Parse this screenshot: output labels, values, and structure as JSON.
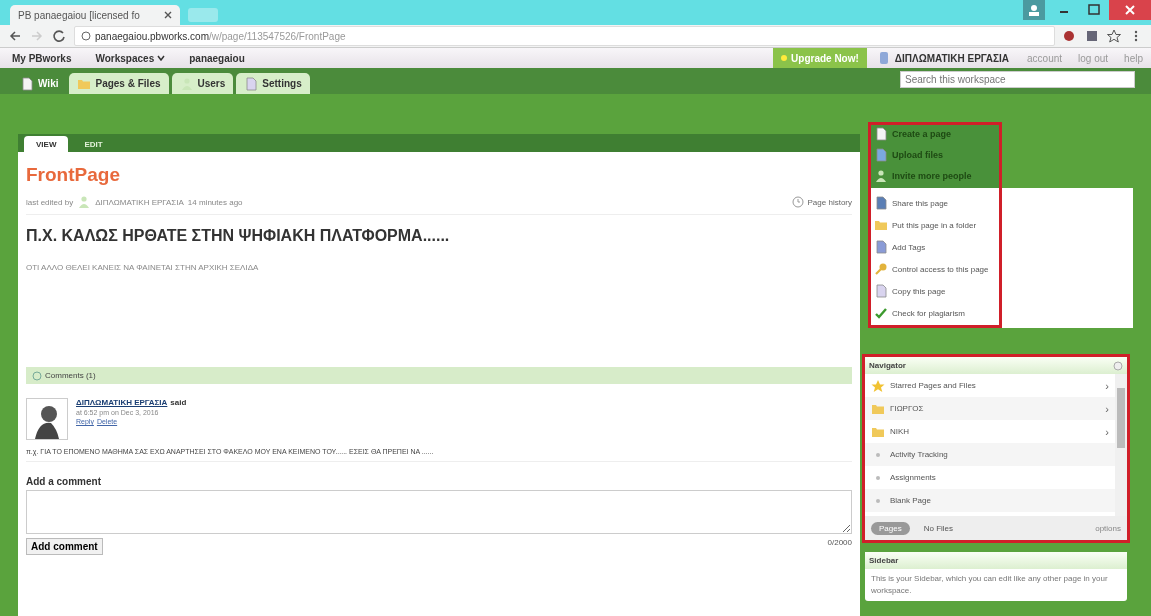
{
  "browser": {
    "tab_title": "PB panaegaiou [licensed fo",
    "url_host": "panaegaiou.pbworks.com",
    "url_path": "/w/page/113547526/FrontPage"
  },
  "topbar": {
    "links": [
      {
        "label": "My PBworks",
        "kind": "plain"
      },
      {
        "label": "Workspaces",
        "kind": "menu"
      },
      {
        "label": "panaegaiou",
        "kind": "plain"
      }
    ],
    "upgrade": "Upgrade Now!",
    "user": "ΔΙΠΛΩΜΑΤΙΚΗ ΕΡΓΑΣΙΑ",
    "right_links": [
      "account",
      "log out",
      "help"
    ]
  },
  "nav": {
    "tabs": [
      {
        "label": "Wiki",
        "selected": true
      },
      {
        "label": "Pages & Files",
        "selected": false
      },
      {
        "label": "Users",
        "selected": false
      },
      {
        "label": "Settings",
        "selected": false
      }
    ],
    "search": {
      "placeholder": "Search this workspace"
    }
  },
  "page": {
    "mode_tabs": [
      {
        "label": "VIEW",
        "selected": true
      },
      {
        "label": "EDIT",
        "selected": false
      }
    ],
    "title": "FrontPage",
    "meta_prefix": "last edited by",
    "meta_user": "ΔΙΠΛΩΜΑΤΙΚΗ ΕΡΓΑΣΙΑ",
    "meta_time": "14 minutes ago",
    "history": "Page history",
    "heading": "Π.Χ. ΚΑΛΩΣ ΗΡΘΑΤΕ ΣΤΗΝ ΨΗΦΙΑΚΗ ΠΛΑΤΦΟΡΜΑ......",
    "body": "ΟΤΙ ΑΛΛΟ ΘΕΛΕΙ ΚΑΝΕΙΣ ΝΑ ΦΑΙΝΕΤΑΙ ΣΤΗΝ ΑΡΧΙΚΗ ΣΕΛΙΔΑ"
  },
  "comments": {
    "header": "Comments (1)",
    "items": [
      {
        "author": "ΔΙΠΛΩΜΑΤΙΚΗ ΕΡΓΑΣΙΑ",
        "said": "said",
        "date": "at 6:52 pm on Dec 3, 2016",
        "actions": [
          "Reply",
          "Delete"
        ],
        "text": "π.χ. ΓΙΑ ΤΟ ΕΠΟΜΕΝΟ ΜΑΘΗΜΑ ΣΑΣ ΕΧΩ ΑΝΑΡΤΗΣΕΙ ΣΤΟ ΦΑΚΕΛΟ ΜΟΥ ΕΝΑ ΚΕΙΜΕΝΟ ΤΟΥ...... ΕΣΕΙΣ ΘΑ ΠΡΕΠΕΙ ΝΑ ......"
      }
    ],
    "add_label": "Add a comment",
    "button": "Add comment",
    "counter": "0/2000"
  },
  "actions": {
    "primary": [
      {
        "label": "Create a page",
        "kind": "page"
      },
      {
        "label": "Upload files",
        "kind": "upload"
      },
      {
        "label": "Invite more people",
        "kind": "people"
      }
    ],
    "secondary": [
      {
        "label": "Share this page",
        "kind": "share"
      },
      {
        "label": "Put this page in a folder",
        "kind": "folder"
      },
      {
        "label": "Add Tags",
        "kind": "tag"
      },
      {
        "label": "Control access to this page",
        "kind": "key"
      },
      {
        "label": "Copy this page",
        "kind": "copy"
      },
      {
        "label": "Check for plagiarism",
        "kind": "check"
      }
    ]
  },
  "navigator": {
    "title": "Navigator",
    "items": [
      {
        "label": "Starred Pages and Files",
        "kind": "star",
        "arrow": "›"
      },
      {
        "label": "ΓΙΩΡΓΟΣ",
        "kind": "folder",
        "arrow": "›"
      },
      {
        "label": "ΝΙΚΗ",
        "kind": "folder",
        "arrow": "›"
      },
      {
        "label": "Activity Tracking",
        "kind": "page"
      },
      {
        "label": "Assignments",
        "kind": "page"
      },
      {
        "label": "Blank Page",
        "kind": "page"
      }
    ],
    "toggles": [
      {
        "label": "Pages",
        "selected": true
      },
      {
        "label": "No Files",
        "selected": false
      }
    ],
    "options": "options"
  },
  "sidebar": {
    "title": "Sidebar",
    "text": "This is your Sidebar, which you can edit like any other page in your workspace."
  }
}
